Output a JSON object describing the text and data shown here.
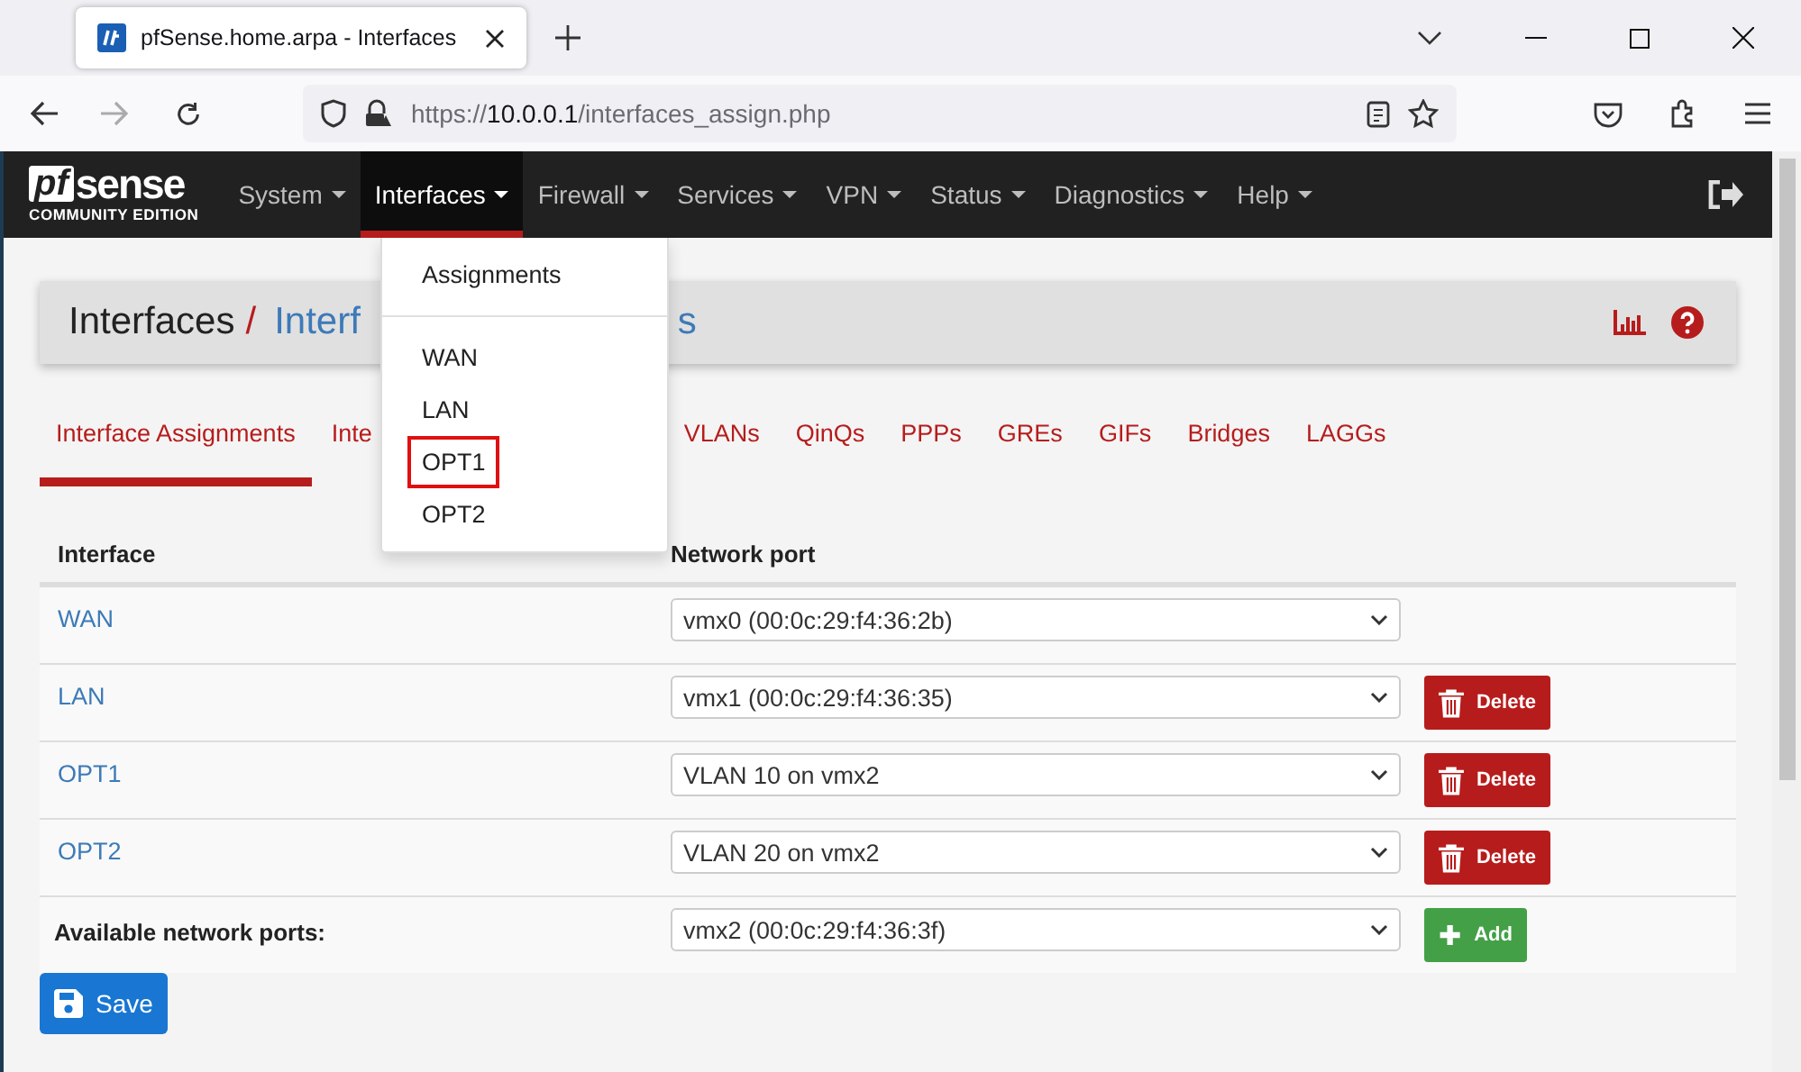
{
  "browser": {
    "tab_title": "pfSense.home.arpa - Interfaces",
    "url": {
      "prefix": "https://",
      "host": "10.0.0.1",
      "path": "/interfaces_assign.php"
    }
  },
  "navbar": {
    "logo": {
      "mark": "pf",
      "word": "sense",
      "edition": "COMMUNITY EDITION"
    },
    "menus": [
      {
        "label": "System",
        "selected": false
      },
      {
        "label": "Interfaces",
        "selected": true
      },
      {
        "label": "Firewall",
        "selected": false
      },
      {
        "label": "Services",
        "selected": false
      },
      {
        "label": "VPN",
        "selected": false
      },
      {
        "label": "Status",
        "selected": false
      },
      {
        "label": "Diagnostics",
        "selected": false
      },
      {
        "label": "Help",
        "selected": false
      }
    ]
  },
  "dropdown": {
    "items": [
      {
        "label": "Assignments",
        "highlighted": false,
        "divider_after": true
      },
      {
        "label": "WAN",
        "highlighted": false,
        "divider_after": false
      },
      {
        "label": "LAN",
        "highlighted": false,
        "divider_after": false
      },
      {
        "label": "OPT1",
        "highlighted": true,
        "divider_after": false
      },
      {
        "label": "OPT2",
        "highlighted": false,
        "divider_after": false
      }
    ]
  },
  "breadcrumb": {
    "section": "Interfaces",
    "separator": "/",
    "page_parts": [
      "Interf",
      "s"
    ]
  },
  "tabs": [
    {
      "label": "Interface Assignments",
      "selected": true
    },
    {
      "label": "Inte",
      "selected": false
    },
    {
      "label": "VLANs",
      "selected": false
    },
    {
      "label": "QinQs",
      "selected": false
    },
    {
      "label": "PPPs",
      "selected": false
    },
    {
      "label": "GREs",
      "selected": false
    },
    {
      "label": "GIFs",
      "selected": false
    },
    {
      "label": "Bridges",
      "selected": false
    },
    {
      "label": "LAGGs",
      "selected": false
    }
  ],
  "table": {
    "columns": [
      "Interface",
      "Network port"
    ],
    "rows": [
      {
        "interface": "WAN",
        "port": "vmx0 (00:0c:29:f4:36:2b)",
        "action": null
      },
      {
        "interface": "LAN",
        "port": "vmx1 (00:0c:29:f4:36:35)",
        "action": "Delete"
      },
      {
        "interface": "OPT1",
        "port": "VLAN 10 on vmx2",
        "action": "Delete"
      },
      {
        "interface": "OPT2",
        "port": "VLAN 20 on vmx2",
        "action": "Delete"
      }
    ],
    "available": {
      "label": "Available network ports:",
      "port": "vmx2 (00:0c:29:f4:36:3f)",
      "action": "Add"
    }
  },
  "save_button": "Save"
}
